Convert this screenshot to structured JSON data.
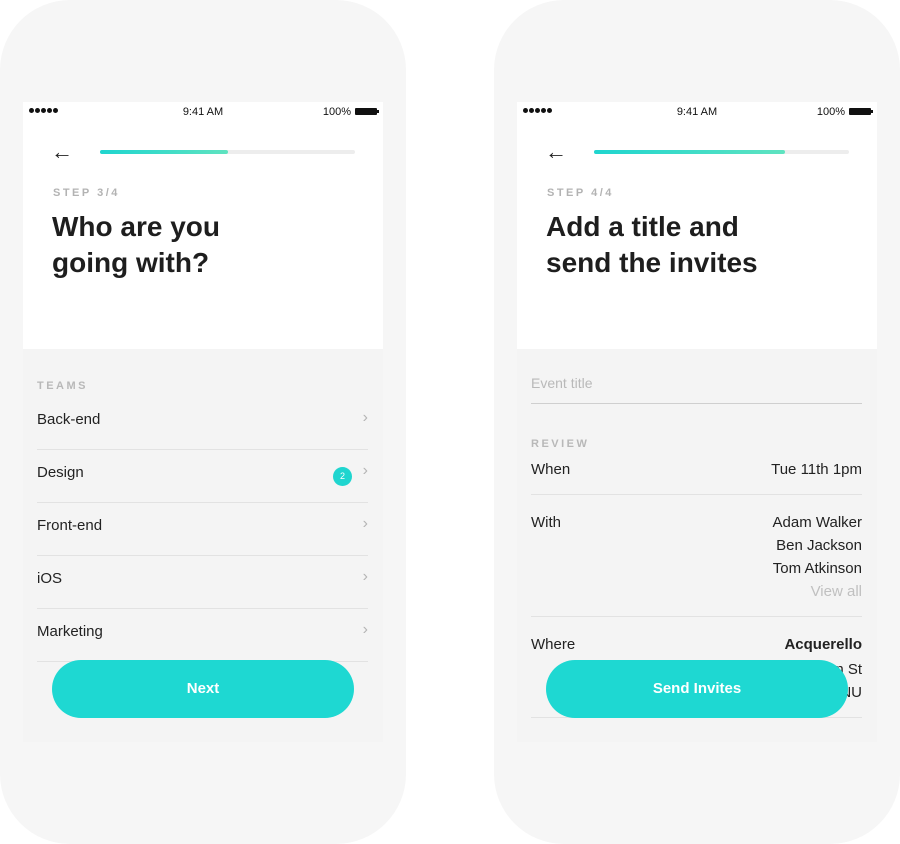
{
  "screens": [
    {
      "status": {
        "time": "9:41 AM",
        "battery": "100%"
      },
      "step": "STEP 3/4",
      "progress": 0.5,
      "title_lines": [
        "Who are you",
        "going with?"
      ],
      "section_label": "TEAMS",
      "teams": [
        {
          "label": "Back-end",
          "badge": ""
        },
        {
          "label": "Design",
          "badge": "2"
        },
        {
          "label": "Front-end",
          "badge": ""
        },
        {
          "label": "iOS",
          "badge": ""
        },
        {
          "label": "Marketing",
          "badge": ""
        }
      ],
      "button_label": "Next"
    },
    {
      "status": {
        "time": "9:41 AM",
        "battery": "100%"
      },
      "step": "STEP 4/4",
      "progress": 0.75,
      "title_lines": [
        "Add a title and",
        "send the invites"
      ],
      "event_title_placeholder": "Event title",
      "section_label": "REVIEW",
      "review": {
        "when_label": "When",
        "when_value": "Tue 11th 1pm",
        "with_label": "With",
        "with_people": [
          "Adam Walker",
          "Ben Jackson",
          "Tom Atkinson"
        ],
        "view_all": "View all",
        "where_label": "Where",
        "where_name": "Acquerello",
        "where_line2_partial": "n St",
        "where_line3_partial": "NU"
      },
      "button_label": "Send Invites"
    }
  ],
  "icons": {
    "back": "arrow-left-icon",
    "chevron": "chevron-right-icon"
  },
  "colors": {
    "accent": "#1ed8d2",
    "background": "#f4f4f4",
    "shell": "#f6f6f6"
  }
}
